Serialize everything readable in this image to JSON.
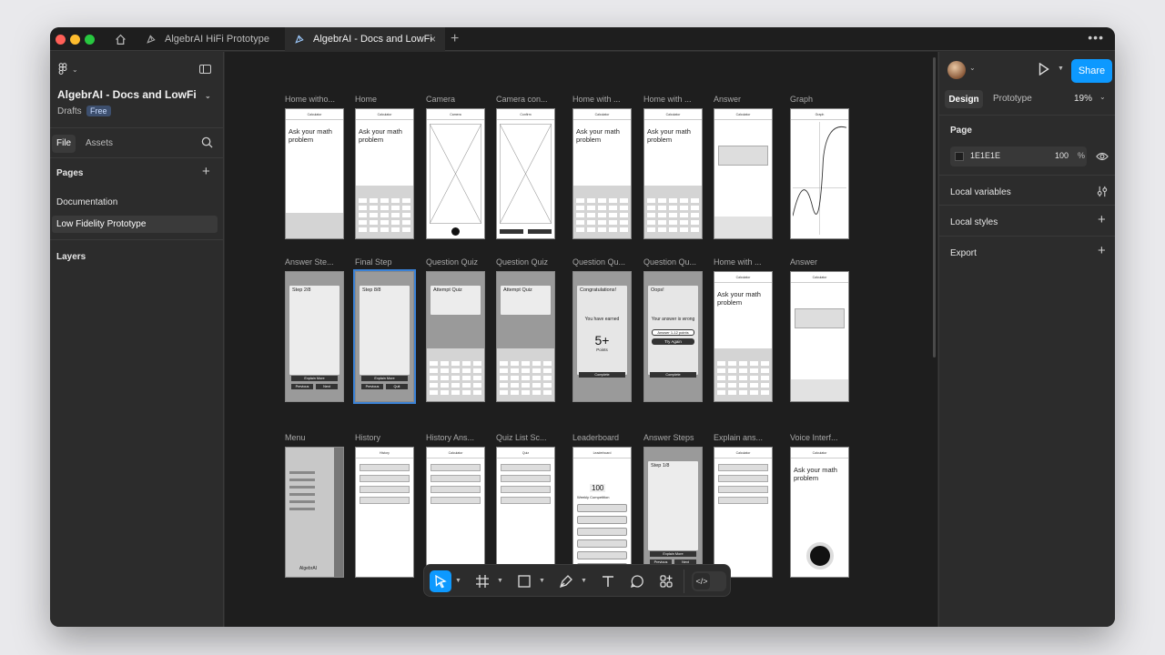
{
  "tabs": [
    {
      "label": "AlgebrAI HiFi Prototype"
    },
    {
      "label": "AlgebrAI - Docs and LowFi"
    }
  ],
  "file": {
    "name": "AlgebrAI - Docs and LowFi",
    "location": "Drafts",
    "plan": "Free"
  },
  "left_tabs": {
    "file": "File",
    "assets": "Assets"
  },
  "pages": {
    "heading": "Pages",
    "items": [
      "Documentation",
      "Low Fidelity Prototype"
    ]
  },
  "layers": {
    "heading": "Layers"
  },
  "right": {
    "share": "Share",
    "design_tab": "Design",
    "prototype_tab": "Prototype",
    "zoom": "19%",
    "page_heading": "Page",
    "page_color": "1E1E1E",
    "page_opacity": "100",
    "percent": "%",
    "local_variables": "Local variables",
    "local_styles": "Local styles",
    "export": "Export"
  },
  "frames": {
    "row1": [
      {
        "label": "Home witho...",
        "title": "Calculator",
        "prompt": "Ask your math problem"
      },
      {
        "label": "Home",
        "title": "Calculator",
        "prompt": "Ask your math problem"
      },
      {
        "label": "Camera",
        "title": "Camera"
      },
      {
        "label": "Camera con...",
        "title": "Confirm"
      },
      {
        "label": "Home with ...",
        "title": "Calculator",
        "prompt": "Ask your math problem"
      },
      {
        "label": "Home with ...",
        "title": "Calculator",
        "prompt": "Ask your math problem"
      },
      {
        "label": "Answer",
        "title": "Calculator"
      },
      {
        "label": "Graph",
        "title": "Graph"
      }
    ],
    "row2": [
      {
        "label": "Answer Ste...",
        "step": "Step 2/8",
        "b1": "Explain More",
        "b2": "Previous",
        "b3": "Next"
      },
      {
        "label": "Final Step",
        "step": "Step 8/8",
        "b1": "Explain More",
        "b2": "Previous",
        "b3": "Quit"
      },
      {
        "label": "Question Quiz",
        "step": "Attempt Quiz"
      },
      {
        "label": "Question Quiz",
        "step": "Attempt Quiz"
      },
      {
        "label": "Question Qu...",
        "step": "Congratulations!",
        "m1": "You have earned",
        "big": "5+",
        "m2": "Points",
        "b1": "Complete"
      },
      {
        "label": "Question Qu...",
        "step": "Oops!",
        "m1": "Your answer is wrong",
        "b0": "Answer 1-12 points",
        "b2": "Try Again",
        "b1": "Complete"
      },
      {
        "label": "Home with ...",
        "title": "Calculator",
        "prompt": "Ask your math problem"
      },
      {
        "label": "Answer",
        "title": "Calculator"
      }
    ],
    "row3": [
      {
        "label": "Menu",
        "footer": "AlgebrAI"
      },
      {
        "label": "History",
        "title": "History"
      },
      {
        "label": "History Ans...",
        "title": "Calculator"
      },
      {
        "label": "Quiz List Sc...",
        "title": "Quiz"
      },
      {
        "label": "Leaderboard",
        "title": "Leaderboard",
        "score": "100",
        "sub": "Weekly Competition"
      },
      {
        "label": "Answer Steps",
        "step": "Step 1/8",
        "b1": "Explain More",
        "b2": "Previous",
        "b3": "Next"
      },
      {
        "label": "Explain ans...",
        "title": "Calculator"
      },
      {
        "label": "Voice Interf...",
        "title": "Calculator",
        "prompt": "Ask your math problem"
      }
    ]
  },
  "help": "?"
}
